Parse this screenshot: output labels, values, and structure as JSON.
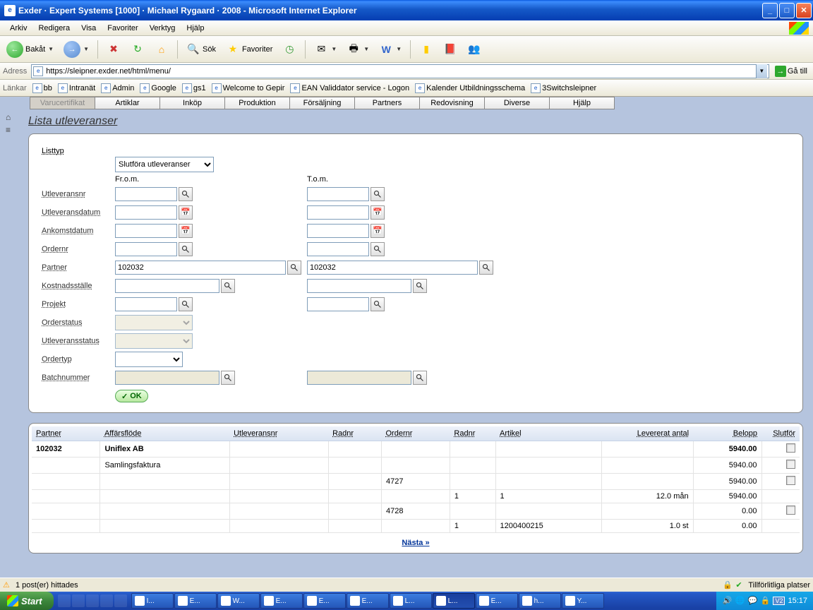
{
  "window": {
    "title": "Exder · Expert Systems [1000] · Michael Rygaard · 2008 - Microsoft Internet Explorer"
  },
  "menubar": {
    "items": [
      "Arkiv",
      "Redigera",
      "Visa",
      "Favoriter",
      "Verktyg",
      "Hjälp"
    ]
  },
  "toolbar": {
    "back": "Bakåt",
    "search": "Sök",
    "favorites": "Favoriter"
  },
  "addressbar": {
    "label": "Adress",
    "url": "https://sleipner.exder.net/html/menu/",
    "go": "Gå till"
  },
  "linksbar": {
    "label": "Länkar",
    "items": [
      "bb",
      "Intranät",
      "Admin",
      "Google",
      "gs1",
      "Welcome to Gepir",
      "EAN Validdator service - Logon",
      "Kalender Utbildningsschema",
      "3Switchsleipner"
    ]
  },
  "app_tabs": [
    "Varucertifikat",
    "Artiklar",
    "Inköp",
    "Produktion",
    "Försäljning",
    "Partners",
    "Redovisning",
    "Diverse",
    "Hjälp"
  ],
  "page": {
    "title": "Lista utleveranser",
    "filters": {
      "listtyp_label": "Listtyp",
      "listtyp_value": "Slutföra utleveranser",
      "from_header": "Fr.o.m.",
      "to_header": "T.o.m.",
      "utleveransnr_label": "Utleveransnr",
      "utleveransdatum_label": "Utleveransdatum",
      "ankomstdatum_label": "Ankomstdatum",
      "ordernr_label": "Ordernr",
      "partner_label": "Partner",
      "partner_from": "102032",
      "partner_to": "102032",
      "kostnad_label": "Kostnadsställe",
      "projekt_label": "Projekt",
      "orderstatus_label": "Orderstatus",
      "utleveransstatus_label": "Utleveransstatus",
      "ordertyp_label": "Ordertyp",
      "batchnummer_label": "Batchnummer",
      "ok_label": "OK"
    },
    "results": {
      "headers": {
        "partner": "Partner",
        "affarsflode": "Affärsflöde",
        "utleveransnr": "Utleveransnr",
        "radnr1": "Radnr",
        "ordernr": "Ordernr",
        "radnr2": "Radnr",
        "artikel": "Artikel",
        "levererat_antal": "Levererat antal",
        "belopp": "Belopp",
        "slutfor": "Slutför"
      },
      "rows": [
        {
          "partner": "102032",
          "affarsflode": "Uniflex AB",
          "utleveransnr": "",
          "radnr1": "",
          "ordernr": "",
          "radnr2": "",
          "artikel": "",
          "levererat": "",
          "belopp": "5940.00",
          "chk": true,
          "bold": true
        },
        {
          "partner": "",
          "affarsflode": "Samlingsfaktura",
          "utleveransnr": "",
          "radnr1": "",
          "ordernr": "",
          "radnr2": "",
          "artikel": "",
          "levererat": "",
          "belopp": "5940.00",
          "chk": true,
          "bold": false
        },
        {
          "partner": "",
          "affarsflode": "",
          "utleveransnr": "",
          "radnr1": "",
          "ordernr": "4727",
          "radnr2": "",
          "artikel": "",
          "levererat": "",
          "belopp": "5940.00",
          "chk": true,
          "bold": false
        },
        {
          "partner": "",
          "affarsflode": "",
          "utleveransnr": "",
          "radnr1": "",
          "ordernr": "",
          "radnr2": "1",
          "artikel": "1",
          "levererat": "12.0 mån",
          "belopp": "5940.00",
          "chk": false,
          "bold": false
        },
        {
          "partner": "",
          "affarsflode": "",
          "utleveransnr": "",
          "radnr1": "",
          "ordernr": "4728",
          "radnr2": "",
          "artikel": "",
          "levererat": "",
          "belopp": "0.00",
          "chk": true,
          "bold": false
        },
        {
          "partner": "",
          "affarsflode": "",
          "utleveransnr": "",
          "radnr1": "",
          "ordernr": "",
          "radnr2": "1",
          "artikel": "1200400215",
          "levererat": "1.0 st",
          "belopp": "0.00",
          "chk": false,
          "bold": false
        }
      ],
      "next": "Nästa »"
    }
  },
  "statusbar": {
    "left": "1 post(er) hittades",
    "right": "Tillförlitliga platser"
  },
  "taskbar": {
    "start": "Start",
    "items": [
      "I...",
      "E...",
      "W...",
      "E...",
      "E...",
      "E...",
      "L...",
      "L...",
      "E...",
      "h...",
      "Y..."
    ],
    "clock": "15:17"
  }
}
